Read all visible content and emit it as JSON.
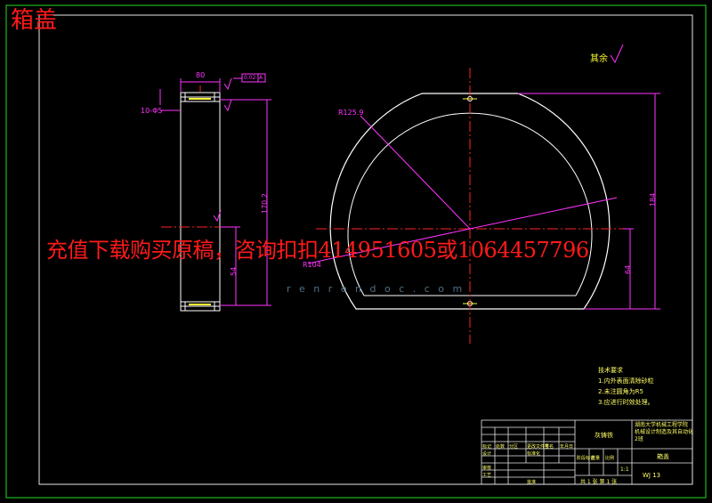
{
  "page_title": "箱盖",
  "overlay_text": "充值下载购买原稿，咨询扣扣414951605或1064457796",
  "watermark": "r e n r e n d o c . c o m",
  "roughness_mark": "其余",
  "dimensions": {
    "side_top_width": "80",
    "side_height": "170.2",
    "side_lower": "54",
    "tol_box_a": "0.02",
    "tol_box_b": "A",
    "side_left_note": "10-Φ5",
    "radius_outer": "R125.9",
    "radius_inner": "R104",
    "front_total_height": "184",
    "front_lower_height": "64"
  },
  "tech_requirements": {
    "heading": "技术要求",
    "items": [
      "1.内外表面清除砂粒",
      "2.未注圆角为R5",
      "3.应进行时效处理。"
    ]
  },
  "title_block": {
    "material": "灰铸铁",
    "school": "湖南大学机械工程学院",
    "project": "机械设计制造及其自动化",
    "project2": "2班",
    "part_name": "箱盖",
    "drawing_no": "WJ 13",
    "scale": "1:1",
    "rows": [
      "标记",
      "处数",
      "分区",
      "更改文件号",
      "签名",
      "年月日"
    ],
    "roles": [
      "设计",
      "审核",
      "工艺",
      "标准化",
      "批准"
    ],
    "stage_labels": [
      "阶段标记",
      "重量",
      "比例"
    ],
    "sheet": "共 1 张  第 1 张"
  },
  "colors": {
    "outline": "#ffffff",
    "frame": "#22dd22",
    "dimension": "#ff33ff",
    "center": "#ff2222",
    "overlay": "#ff1a1a",
    "note": "#ffff33"
  }
}
